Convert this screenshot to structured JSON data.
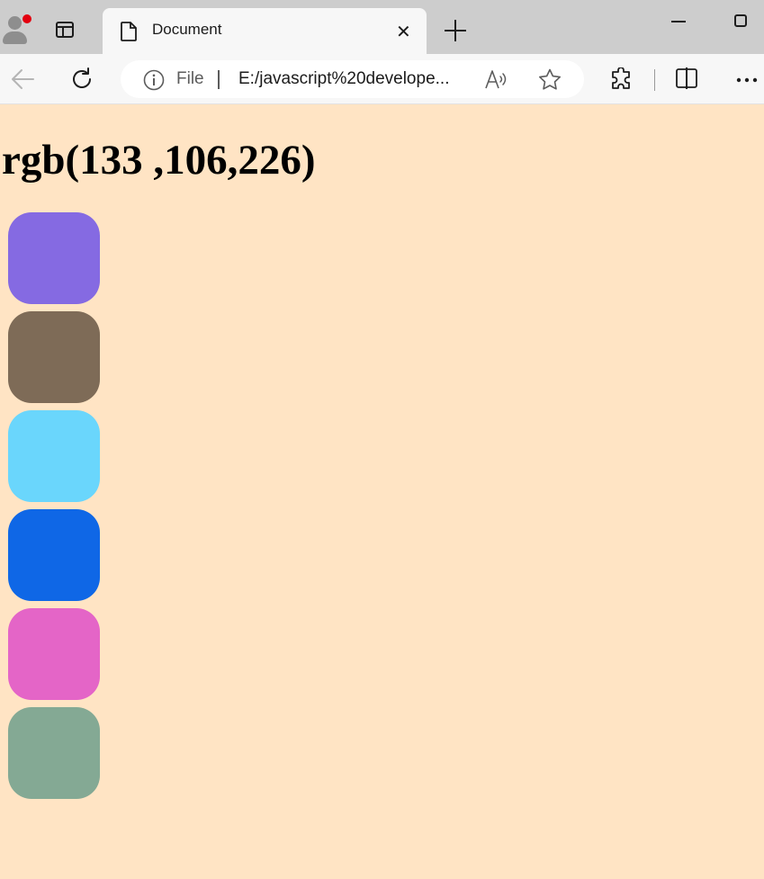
{
  "browser": {
    "tab_title": "Document",
    "address": {
      "scheme_label": "File",
      "url": "E:/javascript%20develope..."
    }
  },
  "page": {
    "heading": "rgb(133 ,106,226)",
    "background_color": "#ffe4c4",
    "swatches": [
      {
        "color": "#856ae2"
      },
      {
        "color": "#7e6b57"
      },
      {
        "color": "#6ad6fc"
      },
      {
        "color": "#0f67e6"
      },
      {
        "color": "#e465c7"
      },
      {
        "color": "#84a994"
      }
    ]
  }
}
